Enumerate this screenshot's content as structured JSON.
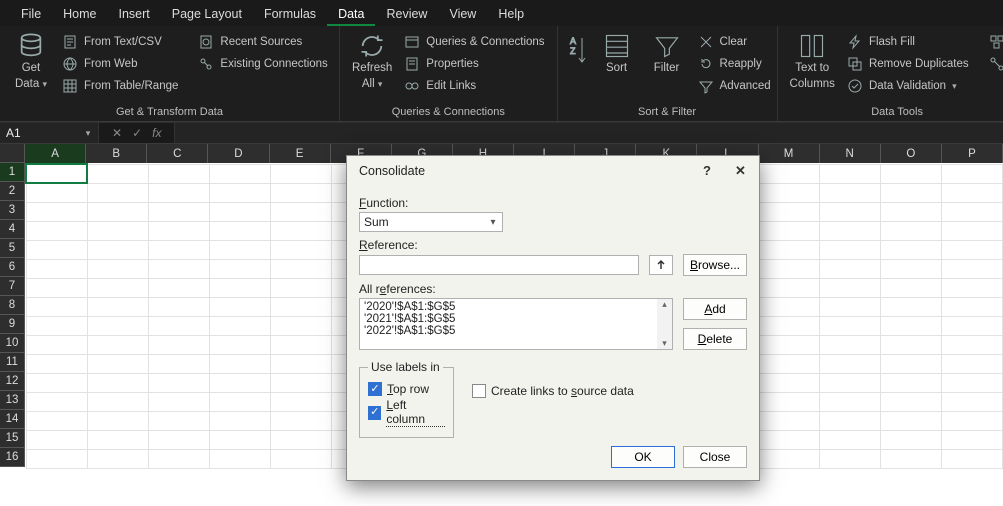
{
  "menubar": {
    "tabs": [
      "File",
      "Home",
      "Insert",
      "Page Layout",
      "Formulas",
      "Data",
      "Review",
      "View",
      "Help"
    ],
    "active": 5
  },
  "ribbon": {
    "groups": [
      {
        "label": "Get & Transform Data",
        "big": {
          "line1": "Get",
          "line2": "Data"
        },
        "items_col1": [
          "From Text/CSV",
          "From Web",
          "From Table/Range"
        ],
        "items_col2": [
          "Recent Sources",
          "Existing Connections"
        ]
      },
      {
        "label": "Queries & Connections",
        "big": {
          "line1": "Refresh",
          "line2": "All"
        },
        "items": [
          "Queries & Connections",
          "Properties",
          "Edit Links"
        ]
      },
      {
        "label": "Sort & Filter",
        "sort_label": "Sort",
        "filter_label": "Filter",
        "items": [
          "Clear",
          "Reapply",
          "Advanced"
        ]
      },
      {
        "label": "Data Tools",
        "big": {
          "line1": "Text to",
          "line2": "Columns"
        },
        "items": [
          "Flash Fill",
          "Remove Duplicates",
          "Data Validation"
        ]
      }
    ]
  },
  "namebox": {
    "value": "A1"
  },
  "grid": {
    "cols": [
      "A",
      "B",
      "C",
      "D",
      "E",
      "F",
      "G",
      "H",
      "I",
      "J",
      "K",
      "L",
      "M",
      "N",
      "O",
      "P"
    ],
    "rows": 16,
    "active_row": 1,
    "active_col": 0
  },
  "dialog": {
    "title": "Consolidate",
    "function_label": "Function:",
    "function_value": "Sum",
    "reference_label": "Reference:",
    "browse": "Browse...",
    "allrefs_label": "All references:",
    "allrefs": [
      "'2020'!$A$1:$G$5",
      "'2021'!$A$1:$G$5",
      "'2022'!$A$1:$G$5"
    ],
    "add": "Add",
    "delete": "Delete",
    "fieldset_legend": "Use labels in",
    "top_row": "Top row",
    "left_column": "Left column",
    "create_links": "Create links to source data",
    "ok": "OK",
    "close": "Close"
  }
}
